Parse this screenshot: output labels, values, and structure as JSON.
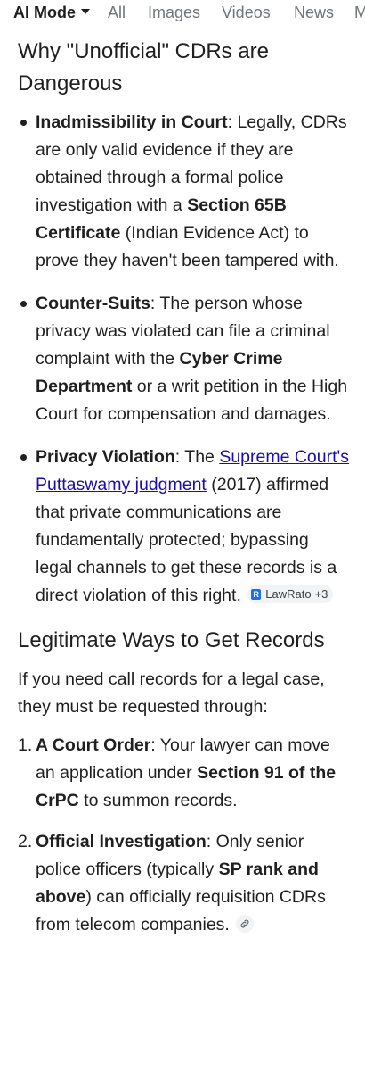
{
  "tabs": [
    {
      "label": "AI Mode",
      "active": true
    },
    {
      "label": "All",
      "active": false
    },
    {
      "label": "Images",
      "active": false
    },
    {
      "label": "Videos",
      "active": false
    },
    {
      "label": "News",
      "active": false
    },
    {
      "label": "M",
      "active": false
    }
  ],
  "section1": {
    "heading": "Why \"Unofficial\" CDRs are Dangerous",
    "items": [
      {
        "term": "Inadmissibility in Court",
        "text_a": ": Legally, CDRs are only valid evidence if they are obtained through a formal police investigation with a ",
        "bold_a": "Section 65B Certificate",
        "text_b": " (Indian Evidence Act) to prove they haven't been tampered with."
      },
      {
        "term": "Counter-Suits",
        "text_a": ": The person whose privacy was violated can file a criminal complaint with the ",
        "bold_a": "Cyber Crime Department",
        "text_b": " or a writ petition in the High Court for compensation and damages."
      },
      {
        "term": "Privacy Violation",
        "text_a": ": The ",
        "link": "Supreme Court's Puttaswamy judgment",
        "text_b": " (2017) affirmed that private communications are fundamentally protected; bypassing legal channels to get these records is a direct violation of this right.",
        "source_chip": {
          "logo": "R",
          "name": "LawRato",
          "count": "+3"
        }
      }
    ]
  },
  "section2": {
    "heading": "Legitimate Ways to Get Records",
    "intro": "If you need call records for a legal case, they must be requested through:",
    "items": [
      {
        "num": "1.",
        "term": "A Court Order",
        "text_a": ": Your lawyer can move an application under ",
        "bold_a": "Section 91 of the CrPC",
        "text_b": " to summon records."
      },
      {
        "num": "2.",
        "term": "Official Investigation",
        "text_a": ": Only senior police officers (typically ",
        "bold_a": "SP rank and above",
        "text_b": ") can officially requisition CDRs from telecom companies.",
        "link_icon": "link-icon"
      }
    ]
  }
}
